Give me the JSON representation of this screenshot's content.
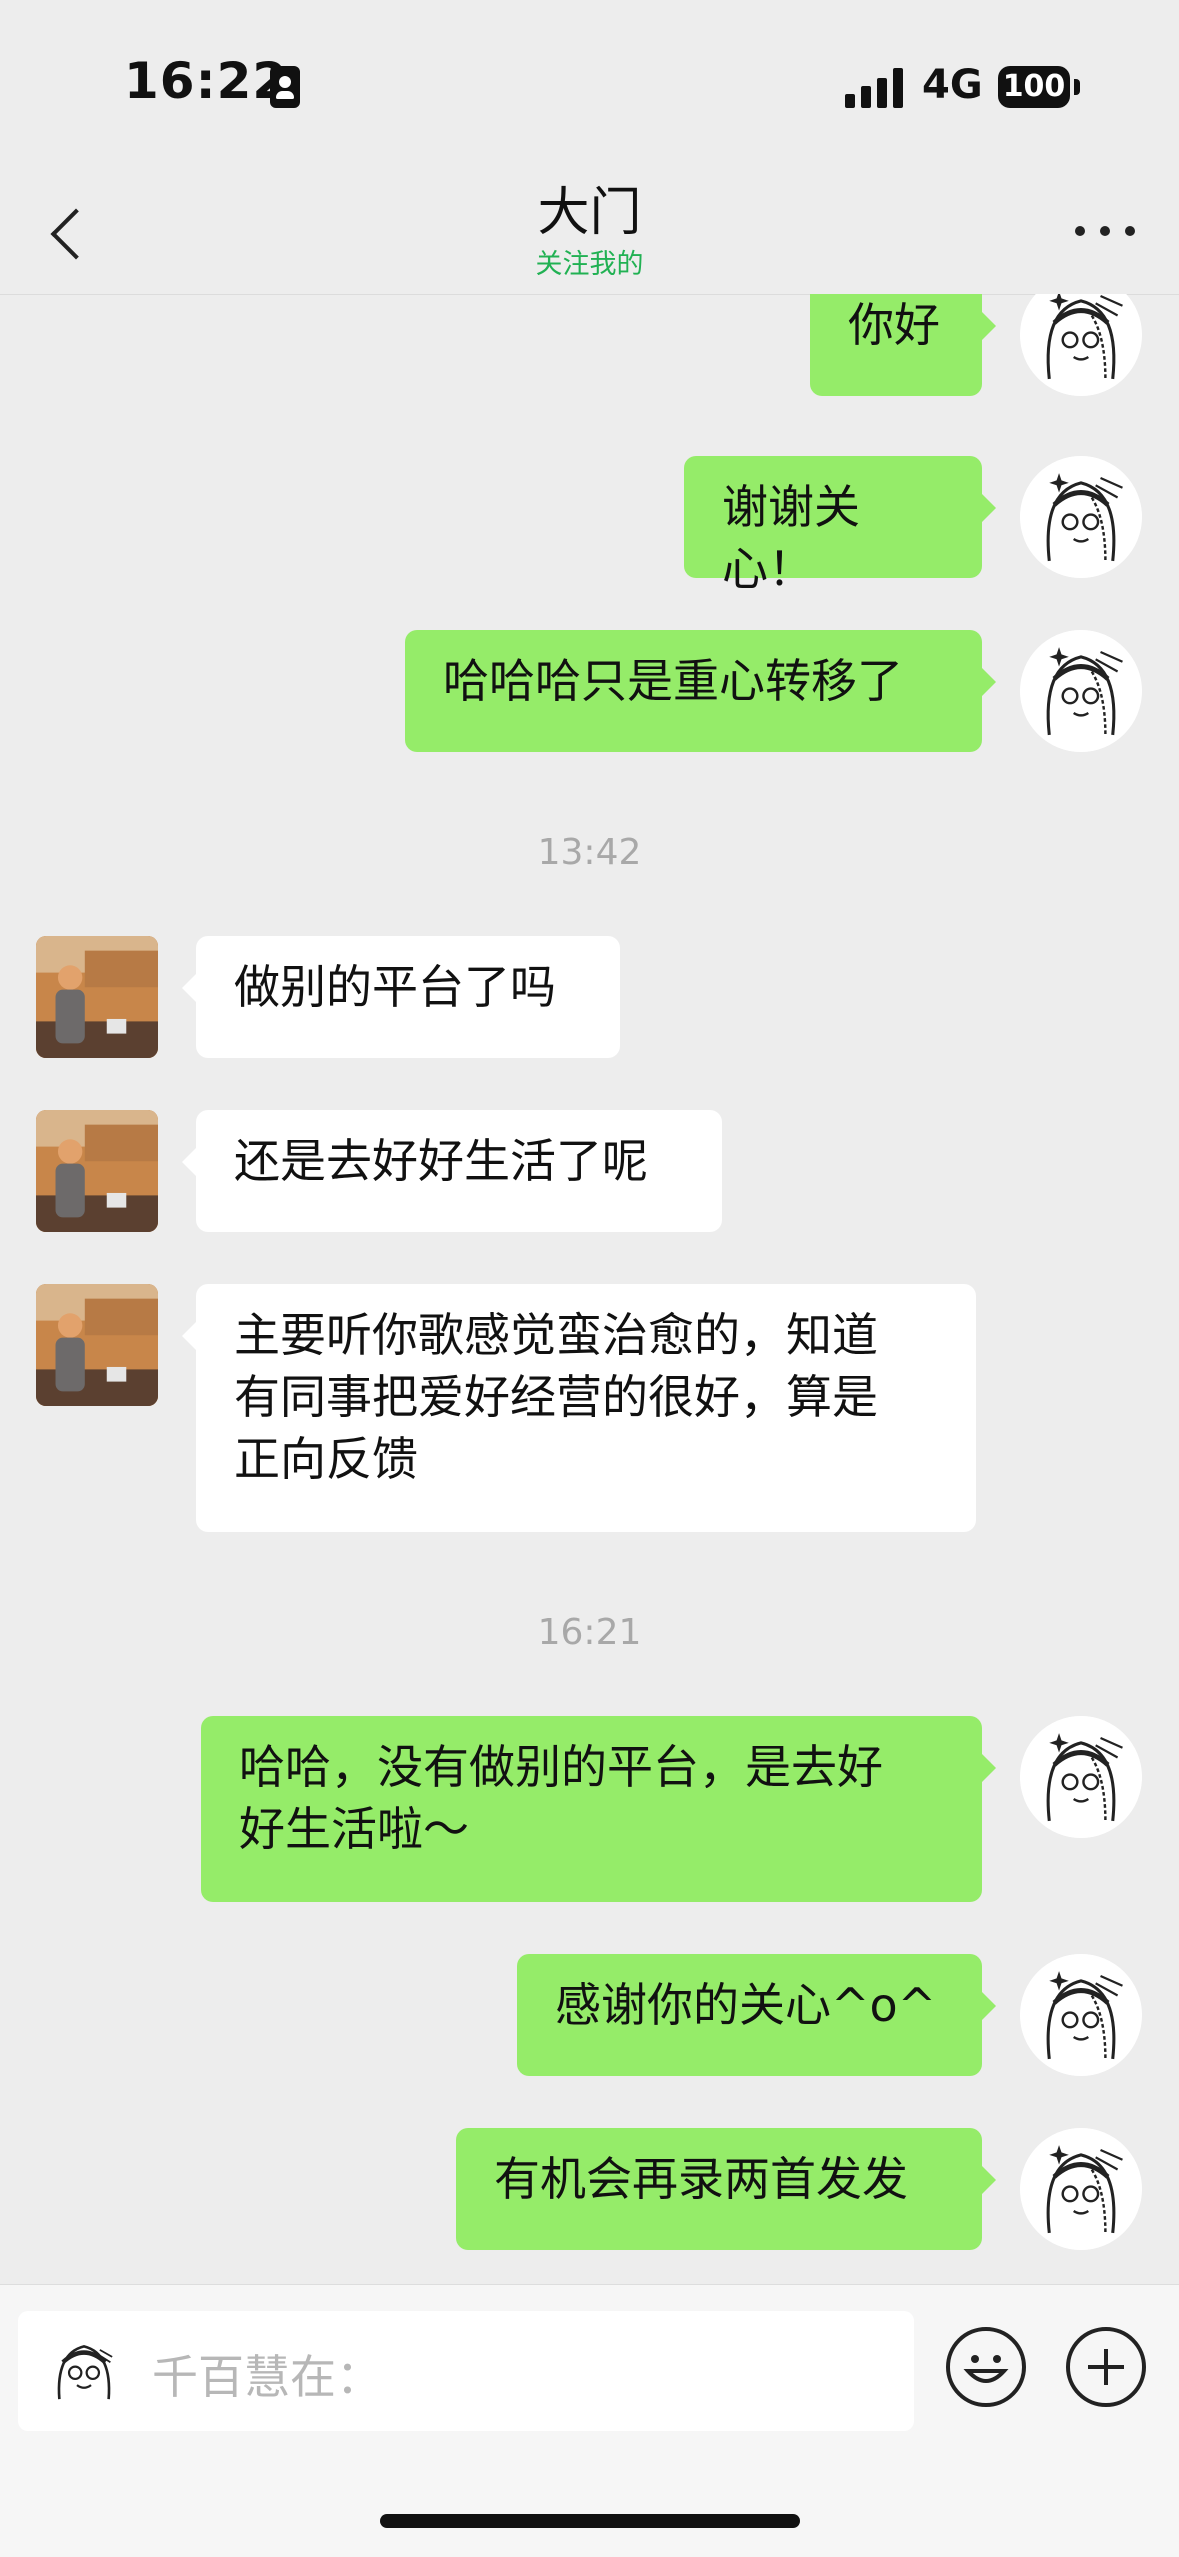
{
  "status": {
    "time": "16:22",
    "network": "4G",
    "battery": "100"
  },
  "nav": {
    "title": "大门",
    "subtitle": "关注我的"
  },
  "messages": [
    {
      "from": "me",
      "text": "你好"
    },
    {
      "from": "me",
      "text": "谢谢关心！"
    },
    {
      "from": "me",
      "text": "哈哈哈只是重心转移了"
    },
    {
      "type": "time",
      "text": "13:42"
    },
    {
      "from": "other",
      "text": "做别的平台了吗"
    },
    {
      "from": "other",
      "text": "还是去好好生活了呢"
    },
    {
      "from": "other",
      "lines": [
        "主要听你歌感觉蛮治愈的，知道",
        "有同事把爱好经营的很好，算是",
        "正向反馈"
      ]
    },
    {
      "type": "time",
      "text": "16:21"
    },
    {
      "from": "me",
      "lines": [
        "哈哈，没有做别的平台，是去好",
        "好生活啦～"
      ]
    },
    {
      "from": "me",
      "text": "感谢你的关心^o^"
    },
    {
      "from": "me",
      "text": "有机会再录两首发发"
    }
  ],
  "input": {
    "placeholder": "千百慧在："
  },
  "colors": {
    "my_bubble": "#95ec69",
    "their_bubble": "#ffffff",
    "accent_green": "#21b153",
    "background": "#ededed"
  },
  "icons": {
    "back": "chevron-left-icon",
    "more": "more-dots-icon",
    "emoji": "emoji-icon",
    "plus": "plus-icon"
  }
}
